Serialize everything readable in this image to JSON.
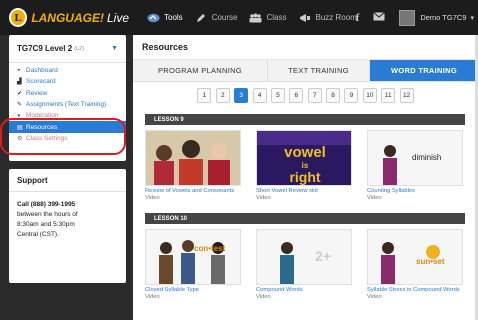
{
  "app": {
    "logo_letter": "L",
    "logo_name": "LANGUAGE!",
    "logo_suffix": "Live"
  },
  "nav": {
    "items": [
      {
        "label": "Tools",
        "icon": "tools-icon",
        "active": true
      },
      {
        "label": "Course",
        "icon": "pencil-icon"
      },
      {
        "label": "Class",
        "icon": "class-icon"
      },
      {
        "label": "Buzz Room",
        "icon": "megaphone-icon"
      }
    ],
    "user_name": "Demo TG7C9"
  },
  "sidebar": {
    "course_title": "TG7C9 Level 2",
    "course_level": "(L2)",
    "items": [
      {
        "label": "Dashboard",
        "icon": "dashboard-icon"
      },
      {
        "label": "Scorecard",
        "icon": "scorecard-icon"
      },
      {
        "label": "Review",
        "icon": "check-icon"
      },
      {
        "label": "Assignments (Text Training)",
        "icon": "pencil-icon"
      },
      {
        "label": "Moderation",
        "icon": "moderation-icon"
      },
      {
        "label": "Resources",
        "icon": "resources-icon"
      },
      {
        "label": "Class Settings",
        "icon": "gear-icon"
      }
    ],
    "support": {
      "title": "Support",
      "phone": "Call (888) 399-1995",
      "line2": "between the hours of",
      "line3": "8:30am and 5:30pm",
      "line4": "Central (CST)."
    }
  },
  "main": {
    "title": "Resources",
    "tabs": [
      "PROGRAM PLANNING",
      "TEXT TRAINING",
      "WORD TRAINING"
    ],
    "active_tab": 2,
    "pages": [
      "1",
      "2",
      "3",
      "4",
      "5",
      "6",
      "7",
      "8",
      "9",
      "10",
      "11",
      "12"
    ],
    "active_page": 2,
    "lessons": [
      {
        "label": "LESSON 9",
        "videos": [
          {
            "title": "Review of Vowels and Consonants",
            "type": "Video",
            "thumb": "people"
          },
          {
            "title": "Short Vowel Review skit",
            "type": "Video",
            "thumb": "vowel",
            "text1": "vowel",
            "text2": "is",
            "text3": "right"
          },
          {
            "title": "Counting Syllables",
            "type": "Video",
            "thumb": "word",
            "word": "diminish"
          }
        ]
      },
      {
        "label": "LESSON 10",
        "videos": [
          {
            "title": "Closed Syllable Type",
            "type": "Video",
            "thumb": "contest",
            "word": "con•test"
          },
          {
            "title": "Compound Words",
            "type": "Video",
            "thumb": "compound",
            "word": "2+"
          },
          {
            "title": "Syllable Stress in Compound Words",
            "type": "Video",
            "thumb": "sunset",
            "word": "sun•set"
          }
        ]
      }
    ]
  }
}
